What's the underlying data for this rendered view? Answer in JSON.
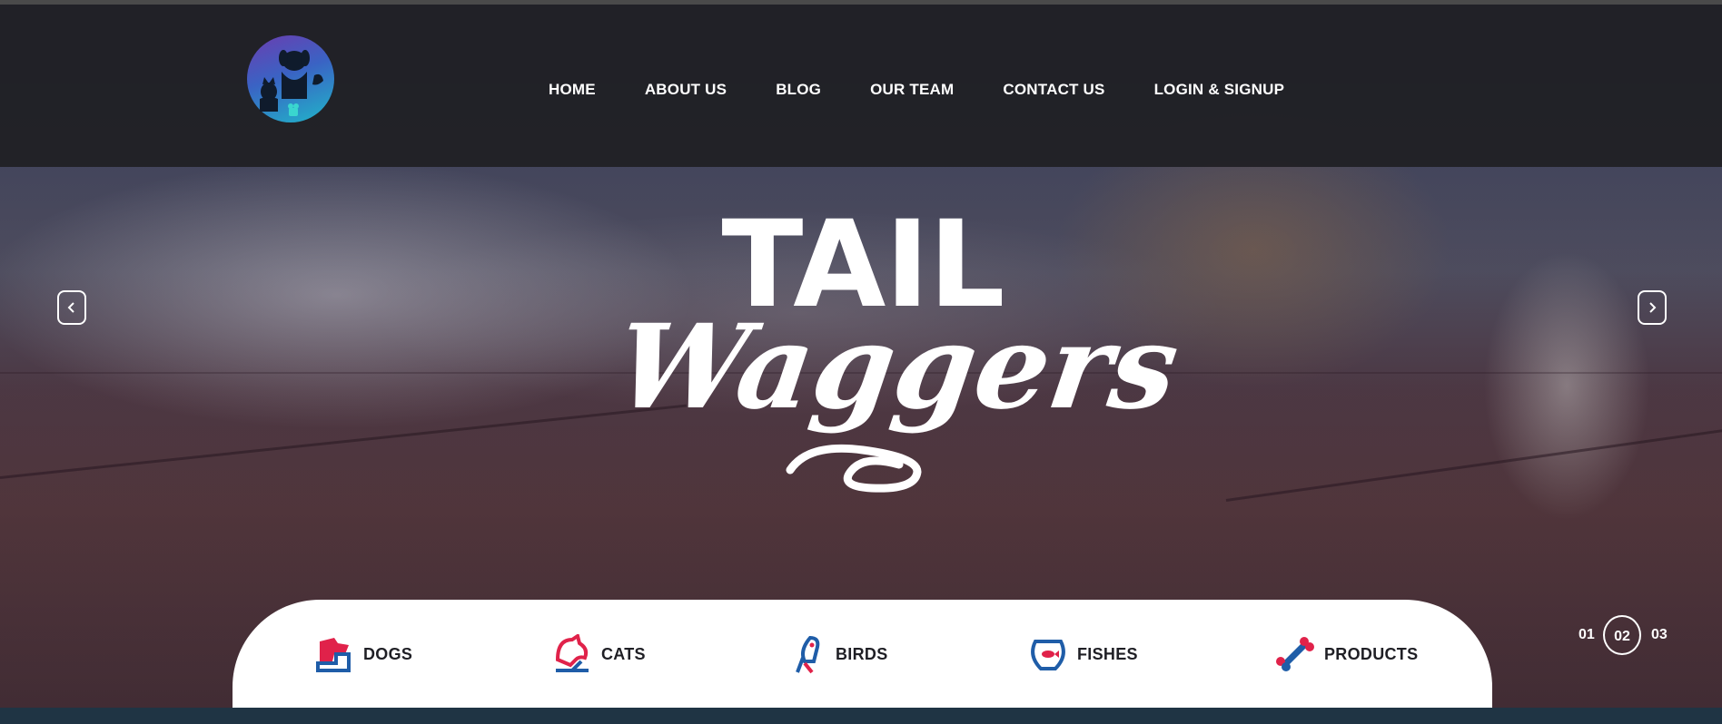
{
  "header": {
    "logo_name": "tail-waggers-logo",
    "nav": [
      {
        "label": "HOME"
      },
      {
        "label": "ABOUT US"
      },
      {
        "label": "BLOG"
      },
      {
        "label": "OUR TEAM"
      },
      {
        "label": "CONTACT US"
      },
      {
        "label": "LOGIN & SIGNUP"
      }
    ]
  },
  "hero": {
    "title_line1": "TAIL",
    "title_line2": "Waggers",
    "prev_icon": "chevron-left-icon",
    "next_icon": "chevron-right-icon"
  },
  "categories": [
    {
      "label": "DOGS",
      "icon": "dog-icon"
    },
    {
      "label": "CATS",
      "icon": "cat-icon"
    },
    {
      "label": "BIRDS",
      "icon": "bird-icon"
    },
    {
      "label": "FISHES",
      "icon": "fishbowl-icon"
    },
    {
      "label": "PRODUCTS",
      "icon": "bone-icon"
    }
  ],
  "slider": {
    "pages": [
      "01",
      "02",
      "03"
    ],
    "current": "02"
  },
  "colors": {
    "header_bg": "#202024",
    "accent_red": "#e0224a",
    "accent_blue": "#1f5da8",
    "text_dark": "#1f1f25"
  }
}
